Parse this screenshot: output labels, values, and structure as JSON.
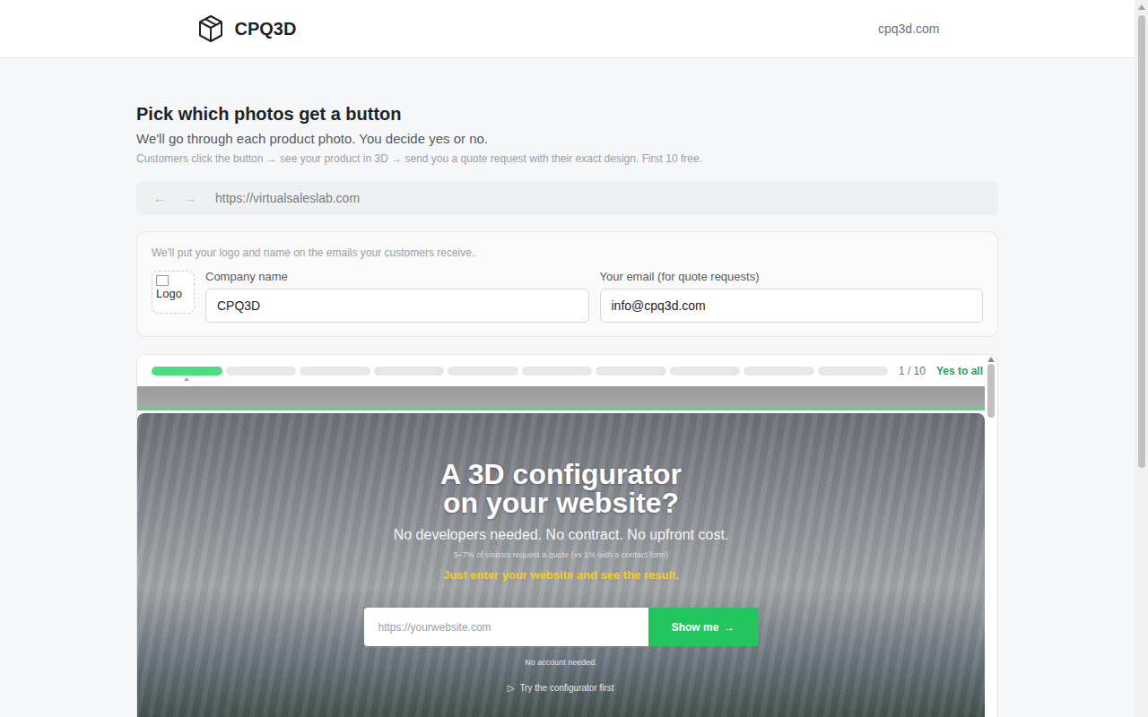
{
  "header": {
    "brand": "CPQ3D",
    "link": "cpq3d.com"
  },
  "intro": {
    "title": "Pick which photos get a button",
    "subtitle": "We'll go through each product photo. You decide yes or no.",
    "note": "Customers click the button → see your product in 3D → send you a quote request with their exact design. First 10 free."
  },
  "browser": {
    "back": "←",
    "forward": "→",
    "url": "https://virtualsaleslab.com"
  },
  "branding": {
    "note": "We'll put your logo and name on the emails your customers receive.",
    "logo_alt": "Logo",
    "company_label": "Company name",
    "company_value": "CPQ3D",
    "email_label": "Your email (for quote requests)",
    "email_value": "info@cpq3d.com"
  },
  "review": {
    "steps": [
      {
        "selected": true
      },
      {
        "selected": false
      },
      {
        "selected": false
      },
      {
        "selected": false
      },
      {
        "selected": false
      },
      {
        "selected": false
      },
      {
        "selected": false
      },
      {
        "selected": false
      },
      {
        "selected": false
      },
      {
        "selected": false
      }
    ],
    "counter": "1 / 10",
    "yes_all": "Yes to all"
  },
  "preview": {
    "headline_1": "A 3D configurator",
    "headline_2": "on your website?",
    "tagline": "No developers needed. No contract. No upfront cost.",
    "stat": "5–7% of visitors request a quote (vs 1% with a contact form)",
    "cta_note": "Just enter your website and see the result.",
    "input_placeholder": "https://yourwebsite.com",
    "button": "Show me",
    "button_icon": "→",
    "footnote": "No account needed.",
    "try_icon": "▷",
    "try": "Try the configurator first"
  }
}
